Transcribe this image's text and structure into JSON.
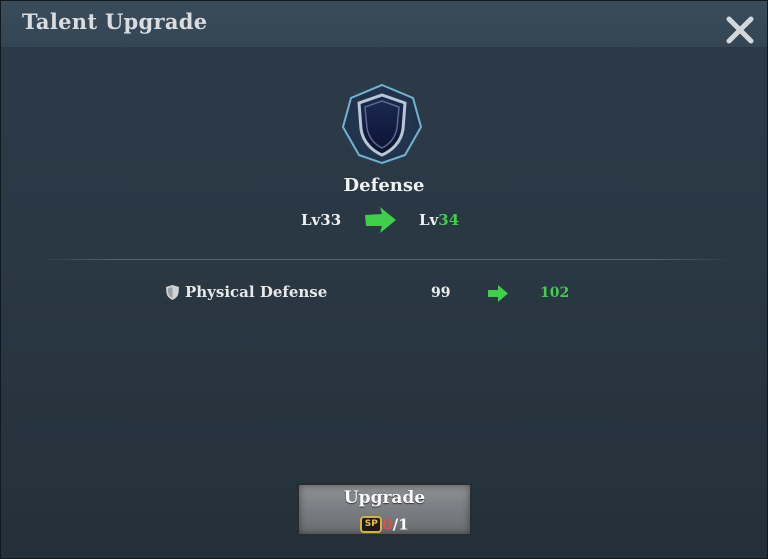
{
  "window": {
    "title": "Talent Upgrade"
  },
  "talent": {
    "name": "Defense",
    "icon": "shield-icon",
    "level_prefix": "Lv",
    "level_current": "33",
    "level_next": "34"
  },
  "stats": [
    {
      "icon": "shield-small-icon",
      "label": "Physical Defense",
      "current": "99",
      "next": "102"
    }
  ],
  "upgrade": {
    "label": "Upgrade",
    "currency_icon": "sp-icon",
    "currency_icon_text": "SP",
    "have": "0",
    "need": "/1"
  },
  "colors": {
    "increase": "#3fcf4a",
    "insufficient": "#e84a3c"
  }
}
